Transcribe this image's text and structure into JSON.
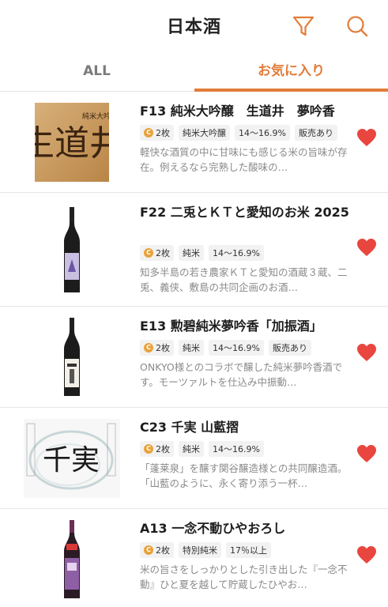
{
  "header": {
    "title": "日本酒",
    "filter_icon": "filter-icon",
    "search_icon": "search-icon"
  },
  "tabs": [
    {
      "label": "ALL"
    },
    {
      "label": "お気に入り"
    }
  ],
  "colors": {
    "accent": "#e27d3a",
    "heart": "#e8463f",
    "coin": "#e9a23b"
  },
  "items": [
    {
      "name": "F13 純米大吟醸　生道井　夢吟香",
      "tags": [
        "2枚",
        "純米大吟醸",
        "14〜16.9%",
        "販売あり"
      ],
      "desc": "軽快な酒質の中に甘味にも感じる米の旨味が存在。例えるなら完熟した酸味の…",
      "favorite": true
    },
    {
      "name": "F22 二兎とＫＴと愛知のお米 2025",
      "tags": [
        "2枚",
        "純米",
        "14〜16.9%"
      ],
      "desc": "知多半島の若き農家ＫＴと愛知の酒蔵３蔵、二兎、義侠、敷島の共同企画のお酒…",
      "favorite": true
    },
    {
      "name": "E13 勲碧純米夢吟香「加振酒」",
      "tags": [
        "2枚",
        "純米",
        "14〜16.9%",
        "販売あり"
      ],
      "desc": "ONKYO様とのコラボで醸した純米夢吟香酒です。モーツァルトを仕込み中振動…",
      "favorite": true
    },
    {
      "name": "C23 千実 山藍摺",
      "tags": [
        "2枚",
        "純米",
        "14〜16.9%"
      ],
      "desc": "「蓬莱泉」を醸す関谷醸造様との共同醸造酒。「山藍のように、永く寄り添う一杯…",
      "favorite": true
    },
    {
      "name": "A13 一念不動ひやおろし",
      "tags": [
        "2枚",
        "特別純米",
        "17％以上"
      ],
      "desc": "米の旨さをしっかりとした引き出した『一念不動』ひと夏を越して貯蔵したひやお…",
      "favorite": true
    }
  ],
  "thumb_text": {
    "t1": "生道井",
    "t4": "千実"
  }
}
